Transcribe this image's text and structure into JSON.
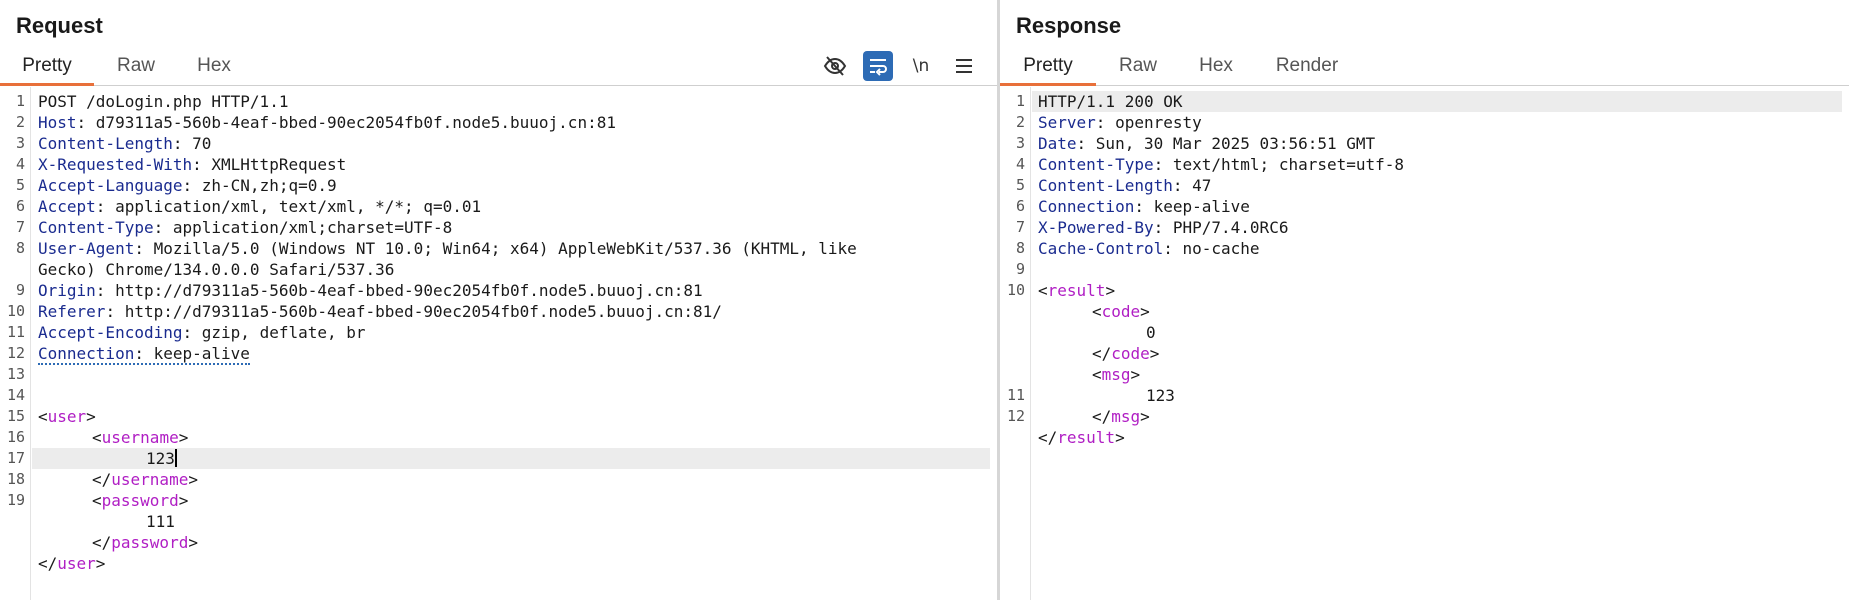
{
  "request": {
    "title": "Request",
    "tabs": [
      "Pretty",
      "Raw",
      "Hex"
    ],
    "toolbar": [
      {
        "name": "hide-nonprintable-icon",
        "glyph": "⊘"
      },
      {
        "name": "wrap-lines-icon",
        "glyph": "↵"
      },
      {
        "name": "show-newlines-icon",
        "glyph": "\\n"
      },
      {
        "name": "menu-icon",
        "glyph": "☰"
      }
    ],
    "lines": [
      {
        "n": "1",
        "key": "",
        "val": "POST /doLogin.php HTTP/1.1"
      },
      {
        "n": "2",
        "key": "Host",
        "val": "d79311a5-560b-4eaf-bbed-90ec2054fb0f.node5.buuoj.cn:81"
      },
      {
        "n": "3",
        "key": "Content-Length",
        "val": "70"
      },
      {
        "n": "4",
        "key": "X-Requested-With",
        "val": "XMLHttpRequest"
      },
      {
        "n": "5",
        "key": "Accept-Language",
        "val": "zh-CN,zh;q=0.9"
      },
      {
        "n": "6",
        "key": "Accept",
        "val": "application/xml, text/xml, */*; q=0.01"
      },
      {
        "n": "7",
        "key": "Content-Type",
        "val": "application/xml;charset=UTF-8"
      },
      {
        "n": "8",
        "key": "User-Agent",
        "val": "Mozilla/5.0 (Windows NT 10.0; Win64; x64) AppleWebKit/537.36 (KHTML, like"
      },
      {
        "n": "",
        "key": "",
        "val": "Gecko) Chrome/134.0.0.0 Safari/537.36"
      },
      {
        "n": "9",
        "key": "Origin",
        "val": "http://d79311a5-560b-4eaf-bbed-90ec2054fb0f.node5.buuoj.cn:81"
      },
      {
        "n": "10",
        "key": "Referer",
        "val": "http://d79311a5-560b-4eaf-bbed-90ec2054fb0f.node5.buuoj.cn:81/"
      },
      {
        "n": "11",
        "key": "Accept-Encoding",
        "val": "gzip, deflate, br"
      },
      {
        "n": "12",
        "key": "Connection",
        "val": "keep-alive"
      },
      {
        "n": "13",
        "key": "",
        "val": ""
      },
      {
        "n": "14",
        "key": "",
        "val": ""
      },
      {
        "n": "15",
        "tag": "user",
        "type": "open",
        "indent": 0
      },
      {
        "n": "16",
        "tag": "username",
        "type": "open",
        "indent": 1
      },
      {
        "n": "17",
        "text": "123",
        "indent": 2,
        "caret": true
      },
      {
        "n": "18",
        "tag": "username",
        "type": "close",
        "indent": 1
      },
      {
        "n": "19",
        "tag": "password",
        "type": "open",
        "indent": 1
      },
      {
        "n": "",
        "text": "111",
        "indent": 2
      },
      {
        "n": "",
        "tag": "password",
        "type": "close",
        "indent": 1
      },
      {
        "n": "",
        "tag": "user",
        "type": "close",
        "indent": 0
      }
    ]
  },
  "response": {
    "title": "Response",
    "tabs": [
      "Pretty",
      "Raw",
      "Hex",
      "Render"
    ],
    "lines": [
      {
        "n": "1",
        "key": "",
        "val": "HTTP/1.1 200 OK"
      },
      {
        "n": "2",
        "key": "Server",
        "val": "openresty"
      },
      {
        "n": "3",
        "key": "Date",
        "val": "Sun, 30 Mar 2025 03:56:51 GMT"
      },
      {
        "n": "4",
        "key": "Content-Type",
        "val": "text/html; charset=utf-8"
      },
      {
        "n": "5",
        "key": "Content-Length",
        "val": "47"
      },
      {
        "n": "6",
        "key": "Connection",
        "val": "keep-alive"
      },
      {
        "n": "7",
        "key": "X-Powered-By",
        "val": "PHP/7.4.0RC6"
      },
      {
        "n": "8",
        "key": "Cache-Control",
        "val": "no-cache"
      },
      {
        "n": "9",
        "key": "",
        "val": ""
      },
      {
        "n": "10",
        "tag": "result",
        "type": "open",
        "indent": 0
      },
      {
        "n": "",
        "tag": "code",
        "type": "open",
        "indent": 1
      },
      {
        "n": "",
        "text": "0",
        "indent": 2
      },
      {
        "n": "",
        "tag": "code",
        "type": "close",
        "indent": 1
      },
      {
        "n": "",
        "tag": "msg",
        "type": "open",
        "indent": 1
      },
      {
        "n": "11",
        "text": "123",
        "indent": 2
      },
      {
        "n": "12",
        "tag": "msg",
        "type": "close",
        "indent": 1
      },
      {
        "n": "",
        "tag": "result",
        "type": "close",
        "indent": 0
      }
    ]
  }
}
